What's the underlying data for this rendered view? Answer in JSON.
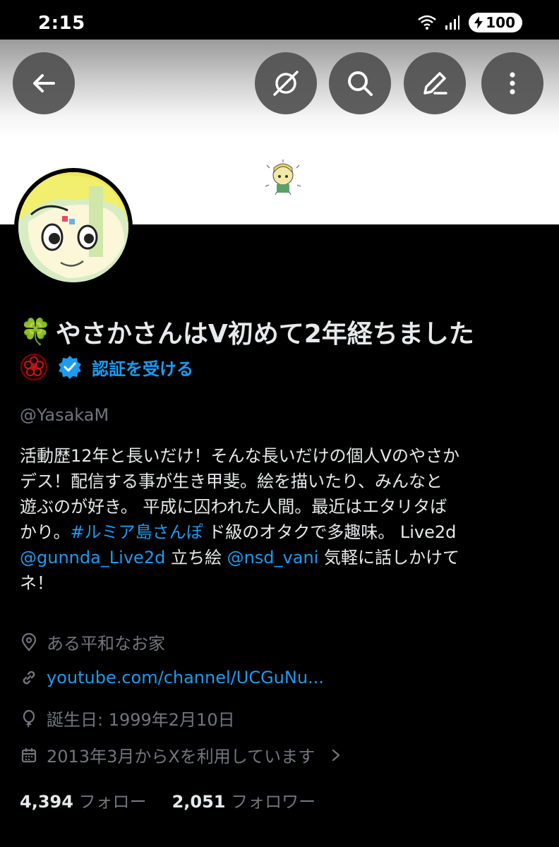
{
  "status_bar": {
    "time": "2:15",
    "battery": "100"
  },
  "header": {
    "back_icon": "arrow-left-icon",
    "grok_icon": "grok-icon",
    "search_icon": "search-icon",
    "edit_icon": "pencil-icon",
    "more_icon": "more-vertical-icon"
  },
  "profile": {
    "display_name": "やさかさんはV初めて2年経ちました",
    "name_emoji": "🍀",
    "verify_label": "認証を受ける",
    "handle": "@YasakaM",
    "bio": {
      "line1": "活動歴12年と長いだけ！そんな長いだけの個人Vのやさか",
      "line2": "デス！配信する事が生き甲斐。絵を描いたり、みんなと",
      "line3": "遊ぶのが好き。 平成に囚われた人間。最近はエタリタば",
      "line4_a": "かり。",
      "hashtag": "#ルミア島さんぽ",
      "line4_b": " ド級のオタクで多趣味。 Live2d",
      "mention1": "@gunnda_Live2d",
      "line5_mid": " 立ち絵 ",
      "mention2": "@nsd_vani",
      "line5_b": " 気軽に話しかけて",
      "line6": "ネ！"
    },
    "location": "ある平和なお家",
    "url": "youtube.com/channel/UCGuNu...",
    "birthday": "誕生日: 1999年2月10日",
    "joined": "2013年3月からXを利用しています",
    "following_count": "4,394",
    "following_label": "フォロー",
    "followers_count": "2,051",
    "followers_label": "フォロワー"
  },
  "colors": {
    "accent": "#1d9bf0",
    "muted": "#71767b",
    "text": "#e7e9ea",
    "bg": "#000000"
  }
}
